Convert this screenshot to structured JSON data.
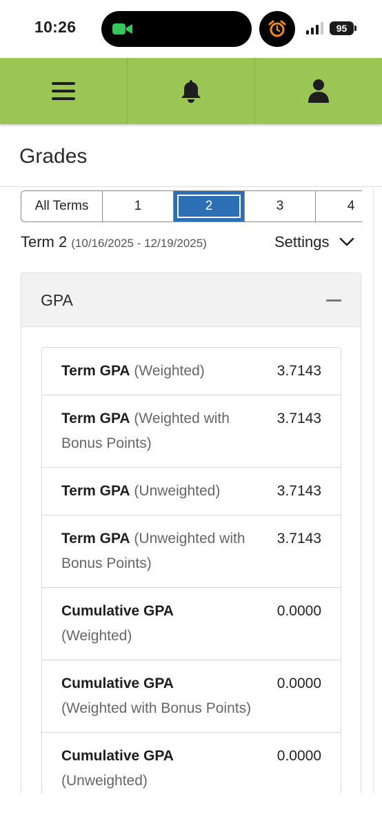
{
  "status_bar": {
    "time": "10:26",
    "battery": "95",
    "icons": [
      "facetime-camera-icon",
      "alarm-clock-icon",
      "cellular-signal-icon",
      "battery-icon"
    ],
    "alarm_color": "#f08a24",
    "camera_color": "#34c759"
  },
  "app_bar": {
    "color": "#9bc656",
    "icons": [
      "hamburger-menu-icon",
      "bell-icon",
      "user-icon"
    ]
  },
  "page": {
    "title": "Grades"
  },
  "term_tabs": {
    "items": [
      "All Terms",
      "1",
      "2",
      "3",
      "4"
    ],
    "active": "2",
    "active_color": "#2d6fb4"
  },
  "term": {
    "label": "Term 2",
    "dates": "(10/16/2025 - 12/19/2025)",
    "settings_label": "Settings"
  },
  "gpa": {
    "title": "GPA",
    "rows": [
      {
        "bold": "Term GPA",
        "rest": "(Weighted)",
        "value": "3.7143"
      },
      {
        "bold": "Term GPA",
        "rest": "(Weighted with Bonus Points)",
        "value": "3.7143"
      },
      {
        "bold": "Term GPA",
        "rest": "(Unweighted)",
        "value": "3.7143"
      },
      {
        "bold": "Term GPA",
        "rest": "(Unweighted with Bonus Points)",
        "value": "3.7143"
      },
      {
        "bold": "Cumulative GPA",
        "rest": "(Weighted)",
        "value": "0.0000"
      },
      {
        "bold": "Cumulative GPA",
        "rest": "(Weighted with Bonus Points)",
        "value": "0.0000"
      },
      {
        "bold": "Cumulative GPA",
        "rest": "(Unweighted)",
        "value": "0.0000"
      }
    ]
  }
}
